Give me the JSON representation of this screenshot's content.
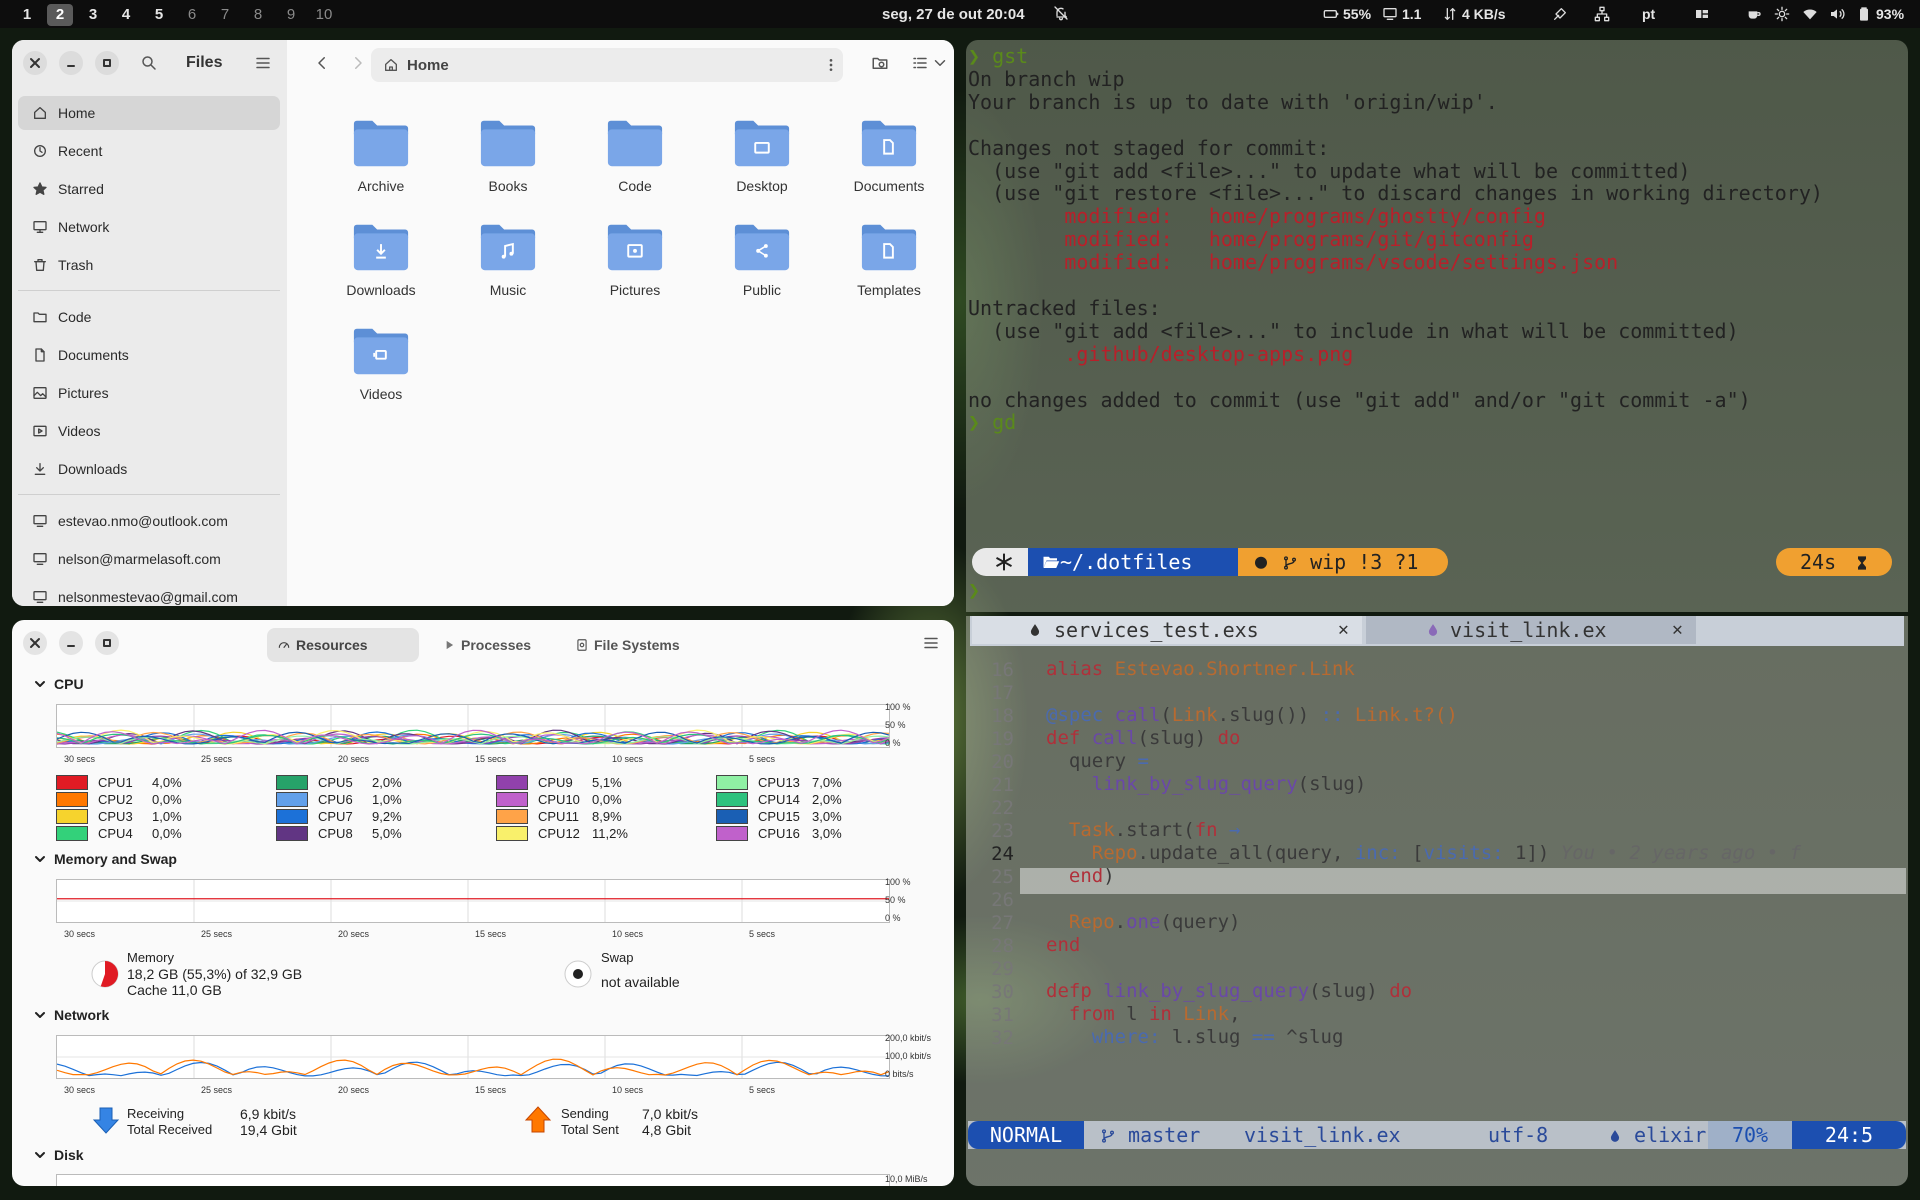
{
  "topbar": {
    "workspaces": [
      "1",
      "2",
      "3",
      "4",
      "5",
      "6",
      "7",
      "8",
      "9",
      "10"
    ],
    "active_workspace": "2",
    "clock": "seg, 27 de out 20:04",
    "battery_saver": "55%",
    "load": "1.1",
    "net_speed": "4 KB/s",
    "lang": "pt",
    "battery": "93%"
  },
  "files": {
    "title": "Files",
    "path": "Home",
    "sidebar_primary": [
      {
        "label": "Home",
        "icon": "home-icon"
      },
      {
        "label": "Recent",
        "icon": "clock-icon"
      },
      {
        "label": "Starred",
        "icon": "star-icon"
      },
      {
        "label": "Network",
        "icon": "network-icon"
      },
      {
        "label": "Trash",
        "icon": "trash-icon"
      }
    ],
    "sidebar_bookmarks": [
      {
        "label": "Code",
        "icon": "folder-icon"
      },
      {
        "label": "Documents",
        "icon": "document-icon"
      },
      {
        "label": "Pictures",
        "icon": "picture-icon"
      },
      {
        "label": "Videos",
        "icon": "video-icon"
      },
      {
        "label": "Downloads",
        "icon": "download-icon"
      }
    ],
    "sidebar_accounts": [
      {
        "label": "estevao.nmo@outlook.com",
        "icon": "online-account-icon"
      },
      {
        "label": "nelson@marmelasoft.com",
        "icon": "online-account-icon"
      },
      {
        "label": "nelsonmestevao@gmail.com",
        "icon": "online-account-icon"
      }
    ],
    "folders": [
      {
        "label": "Archive",
        "glyph": ""
      },
      {
        "label": "Books",
        "glyph": ""
      },
      {
        "label": "Code",
        "glyph": ""
      },
      {
        "label": "Desktop",
        "glyph": "desktop"
      },
      {
        "label": "Documents",
        "glyph": "document"
      },
      {
        "label": "Downloads",
        "glyph": "download"
      },
      {
        "label": "Music",
        "glyph": "music"
      },
      {
        "label": "Pictures",
        "glyph": "picture"
      },
      {
        "label": "Public",
        "glyph": "share"
      },
      {
        "label": "Templates",
        "glyph": "document"
      },
      {
        "label": "Videos",
        "glyph": "video"
      }
    ],
    "folder_color": "#7aa6e8"
  },
  "monitor": {
    "tabs": [
      "Resources",
      "Processes",
      "File Systems"
    ],
    "sections": {
      "cpu": "CPU",
      "memory": "Memory and Swap",
      "network": "Network",
      "disk": "Disk"
    },
    "time_ticks": [
      "30 secs",
      "25 secs",
      "20 secs",
      "15 secs",
      "10 secs",
      "5 secs"
    ],
    "pct_ticks": [
      "100 %",
      "50 %",
      "0 %"
    ],
    "net_ticks": [
      "200,0 kbit/s",
      "100,0 kbit/s",
      "0 bits/s"
    ],
    "disk_tick": "10,0 MiB/s",
    "cpus": [
      {
        "name": "CPU1",
        "value": "4,0%",
        "color": "#e01b24"
      },
      {
        "name": "CPU2",
        "value": "0,0%",
        "color": "#ff7800"
      },
      {
        "name": "CPU3",
        "value": "1,0%",
        "color": "#f6d32d"
      },
      {
        "name": "CPU4",
        "value": "0,0%",
        "color": "#33d17a"
      },
      {
        "name": "CPU5",
        "value": "2,0%",
        "color": "#26a269"
      },
      {
        "name": "CPU6",
        "value": "1,0%",
        "color": "#62a0ea"
      },
      {
        "name": "CPU7",
        "value": "9,2%",
        "color": "#1c71d8"
      },
      {
        "name": "CPU8",
        "value": "5,0%",
        "color": "#613583"
      },
      {
        "name": "CPU9",
        "value": "5,1%",
        "color": "#9141ac"
      },
      {
        "name": "CPU10",
        "value": "0,0%",
        "color": "#c061cb"
      },
      {
        "name": "CPU11",
        "value": "8,9%",
        "color": "#ffa348"
      },
      {
        "name": "CPU12",
        "value": "11,2%",
        "color": "#f9f06b"
      },
      {
        "name": "CPU13",
        "value": "7,0%",
        "color": "#8ff0a4"
      },
      {
        "name": "CPU14",
        "value": "2,0%",
        "color": "#2ec27e"
      },
      {
        "name": "CPU15",
        "value": "3,0%",
        "color": "#1a5fb4"
      },
      {
        "name": "CPU16",
        "value": "3,0%",
        "color": "#c061cb"
      }
    ],
    "memory": {
      "label": "Memory",
      "detail": "18,2 GB (55,3%) of 32,9 GB",
      "cache": "Cache 11,0 GB",
      "fraction": 0.553
    },
    "swap": {
      "label": "Swap",
      "detail": "not available"
    },
    "network": {
      "receiving_label": "Receiving",
      "receiving": "6,9 kbit/s",
      "total_received_label": "Total Received",
      "total_received": "19,4 Gbit",
      "sending_label": "Sending",
      "sending": "7,0 kbit/s",
      "total_sent_label": "Total Sent",
      "total_sent": "4,8 Gbit"
    }
  },
  "terminal": {
    "lines": [
      {
        "t": "❯ gst",
        "c": "green"
      },
      {
        "t": "On branch wip",
        "c": ""
      },
      {
        "t": "Your branch is up to date with 'origin/wip'.",
        "c": ""
      },
      {
        "t": "",
        "c": ""
      },
      {
        "t": "Changes not staged for commit:",
        "c": ""
      },
      {
        "t": "  (use \"git add <file>...\" to update what will be committed)",
        "c": ""
      },
      {
        "t": "  (use \"git restore <file>...\" to discard changes in working directory)",
        "c": ""
      },
      {
        "t": "        modified:   home/programs/ghostty/config",
        "c": "red"
      },
      {
        "t": "        modified:   home/programs/git/gitconfig",
        "c": "red"
      },
      {
        "t": "        modified:   home/programs/vscode/settings.json",
        "c": "red"
      },
      {
        "t": "",
        "c": ""
      },
      {
        "t": "Untracked files:",
        "c": ""
      },
      {
        "t": "  (use \"git add <file>...\" to include in what will be committed)",
        "c": ""
      },
      {
        "t": "        .github/desktop-apps.png",
        "c": "red"
      },
      {
        "t": "",
        "c": ""
      },
      {
        "t": "no changes added to commit (use \"git add\" and/or \"git commit -a\")",
        "c": ""
      },
      {
        "t": "❯ gd",
        "c": "green"
      }
    ],
    "prompt": {
      "dir": "~/.dotfiles",
      "branch": "wip !3 ?1",
      "duration": "24s"
    }
  },
  "editor": {
    "tabs": [
      "services_test.exs",
      "visit_link.ex"
    ],
    "line_numbers": [
      "16",
      "17",
      "18",
      "19",
      "20",
      "21",
      "22",
      "23",
      "24",
      "25",
      "26",
      "27",
      "28",
      "29",
      "30",
      "31",
      "32"
    ],
    "current_line": "24",
    "code": [
      [
        {
          "t": "alias ",
          "k": "kw"
        },
        {
          "t": "Estevao.Shortner.Link",
          "k": "tp"
        }
      ],
      [],
      [
        {
          "t": "@spec ",
          "k": "pu"
        },
        {
          "t": "call",
          "k": "fn"
        },
        {
          "t": "(",
          "k": ""
        },
        {
          "t": "Link",
          "k": "tp"
        },
        {
          "t": ".slug()) ",
          "k": ""
        },
        {
          "t": "::",
          "k": "pu"
        },
        {
          "t": " Link.t?()",
          "k": "tp"
        }
      ],
      [
        {
          "t": "def ",
          "k": "kw"
        },
        {
          "t": "call",
          "k": "fn"
        },
        {
          "t": "(slug) ",
          "k": ""
        },
        {
          "t": "do",
          "k": "kw"
        }
      ],
      [
        {
          "t": "  query ",
          "k": ""
        },
        {
          "t": "=",
          "k": "pu"
        }
      ],
      [
        {
          "t": "    link_by_slug_query",
          "k": "fn"
        },
        {
          "t": "(slug)",
          "k": ""
        }
      ],
      [],
      [
        {
          "t": "  Task",
          "k": "tp"
        },
        {
          "t": ".start(",
          "k": ""
        },
        {
          "t": "fn ",
          "k": "kw"
        },
        {
          "t": "→",
          "k": "pu"
        }
      ],
      [
        {
          "t": "    Repo",
          "k": "tp"
        },
        {
          "t": ".update_all(query, ",
          "k": ""
        },
        {
          "t": "inc:",
          "k": "pu"
        },
        {
          "t": " [",
          "k": ""
        },
        {
          "t": "visits:",
          "k": "pu"
        },
        {
          "t": " 1]) ",
          "k": ""
        },
        {
          "t": "You • 2 years ago • f",
          "k": "cm"
        }
      ],
      [
        {
          "t": "  end",
          "k": "kw"
        },
        {
          "t": ")",
          "k": ""
        }
      ],
      [],
      [
        {
          "t": "  Repo",
          "k": "tp"
        },
        {
          "t": ".",
          "k": ""
        },
        {
          "t": "one",
          "k": "fn"
        },
        {
          "t": "(query)",
          "k": ""
        }
      ],
      [
        {
          "t": "end",
          "k": "kw"
        }
      ],
      [],
      [
        {
          "t": "defp ",
          "k": "kw"
        },
        {
          "t": "link_by_slug_query",
          "k": "fn"
        },
        {
          "t": "(slug) ",
          "k": ""
        },
        {
          "t": "do",
          "k": "kw"
        }
      ],
      [
        {
          "t": "  from ",
          "k": "kw"
        },
        {
          "t": "l ",
          "k": ""
        },
        {
          "t": "in ",
          "k": "kw"
        },
        {
          "t": "Link",
          "k": "tp"
        },
        {
          "t": ",",
          "k": ""
        }
      ],
      [
        {
          "t": "    where:",
          "k": "pu"
        },
        {
          "t": " l.slug ",
          "k": ""
        },
        {
          "t": "==",
          "k": "pu"
        },
        {
          "t": " ^slug",
          "k": ""
        }
      ]
    ],
    "status": {
      "mode": "NORMAL",
      "branch": "master",
      "file": "visit_link.ex",
      "encoding": "utf-8",
      "filetype": "elixir",
      "percent": "70%",
      "position": "24:5"
    }
  }
}
